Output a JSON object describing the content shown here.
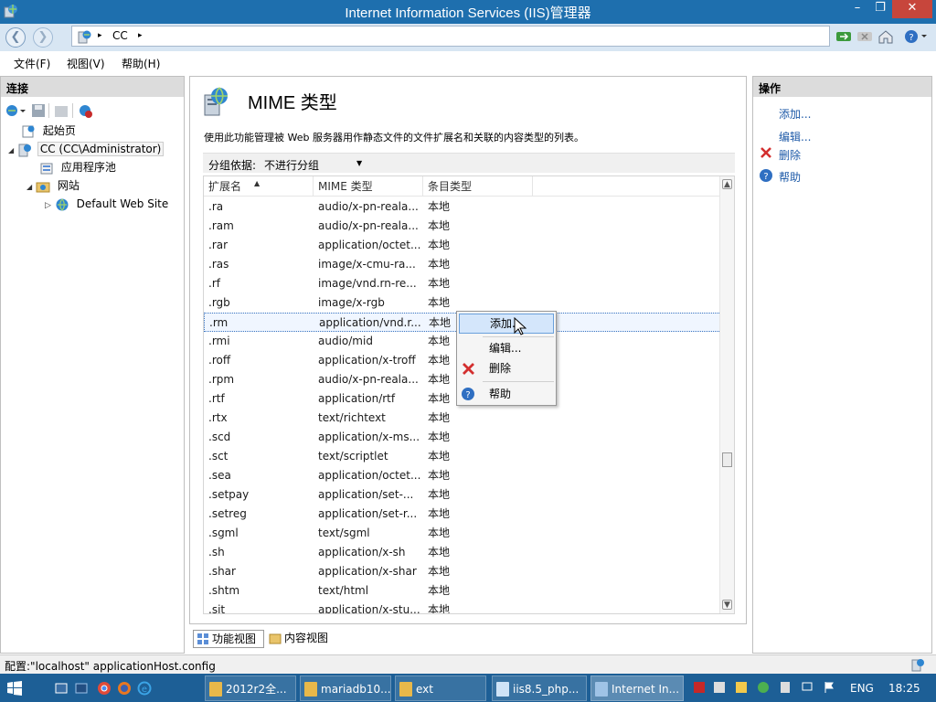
{
  "window": {
    "title": "Internet Information Services (IIS)管理器",
    "controls": {
      "minimize": "–",
      "maximize": "❐",
      "close": "✕"
    }
  },
  "navbar": {
    "back_icon": "back-arrow-icon",
    "forward_icon": "forward-arrow-icon",
    "breadcrumb": [
      "CC"
    ],
    "separator": "▸"
  },
  "menu": [
    "文件(F)",
    "视图(V)",
    "帮助(H)"
  ],
  "connections": {
    "title": "连接",
    "tree": [
      {
        "label": "起始页",
        "level": 0
      },
      {
        "label": "CC (CC\\Administrator)",
        "level": 0
      },
      {
        "label": "应用程序池",
        "level": 1
      },
      {
        "label": "网站",
        "level": 1
      },
      {
        "label": "Default Web Site",
        "level": 2
      }
    ]
  },
  "feature": {
    "title": "MIME 类型",
    "description": "使用此功能管理被 Web 服务器用作静态文件的文件扩展名和关联的内容类型的列表。",
    "group_label": "分组依据:",
    "group_value": "不进行分组",
    "columns": [
      "扩展名",
      "MIME 类型",
      "条目类型"
    ],
    "rows": [
      [
        ".ra",
        "audio/x-pn-reala...",
        "本地"
      ],
      [
        ".ram",
        "audio/x-pn-reala...",
        "本地"
      ],
      [
        ".rar",
        "application/octet...",
        "本地"
      ],
      [
        ".ras",
        "image/x-cmu-ra...",
        "本地"
      ],
      [
        ".rf",
        "image/vnd.rn-re...",
        "本地"
      ],
      [
        ".rgb",
        "image/x-rgb",
        "本地"
      ],
      [
        ".rm",
        "application/vnd.r...",
        "本地"
      ],
      [
        ".rmi",
        "audio/mid",
        "本地"
      ],
      [
        ".roff",
        "application/x-troff",
        "本地"
      ],
      [
        ".rpm",
        "audio/x-pn-reala...",
        "本地"
      ],
      [
        ".rtf",
        "application/rtf",
        "本地"
      ],
      [
        ".rtx",
        "text/richtext",
        "本地"
      ],
      [
        ".scd",
        "application/x-ms...",
        "本地"
      ],
      [
        ".sct",
        "text/scriptlet",
        "本地"
      ],
      [
        ".sea",
        "application/octet...",
        "本地"
      ],
      [
        ".setpay",
        "application/set-...",
        "本地"
      ],
      [
        ".setreg",
        "application/set-r...",
        "本地"
      ],
      [
        ".sgml",
        "text/sgml",
        "本地"
      ],
      [
        ".sh",
        "application/x-sh",
        "本地"
      ],
      [
        ".shar",
        "application/x-shar",
        "本地"
      ],
      [
        ".shtm",
        "text/html",
        "本地"
      ],
      [
        ".sit",
        "application/x-stu...",
        "本地"
      ]
    ],
    "selected_row": 6
  },
  "context_menu": [
    "添加...",
    "编辑...",
    "删除",
    "帮助"
  ],
  "actions": {
    "title": "操作",
    "items": [
      "添加...",
      "编辑...",
      "删除",
      "帮助"
    ]
  },
  "bottom_tabs": [
    "功能视图",
    "内容视图"
  ],
  "status": "配置:\"localhost\" applicationHost.config",
  "taskbar": {
    "items": [
      "2012r2全...",
      "mariadb10...",
      "ext",
      "iis8.5_php...",
      "Internet In..."
    ],
    "lang": "ENG",
    "time": "18:25"
  }
}
